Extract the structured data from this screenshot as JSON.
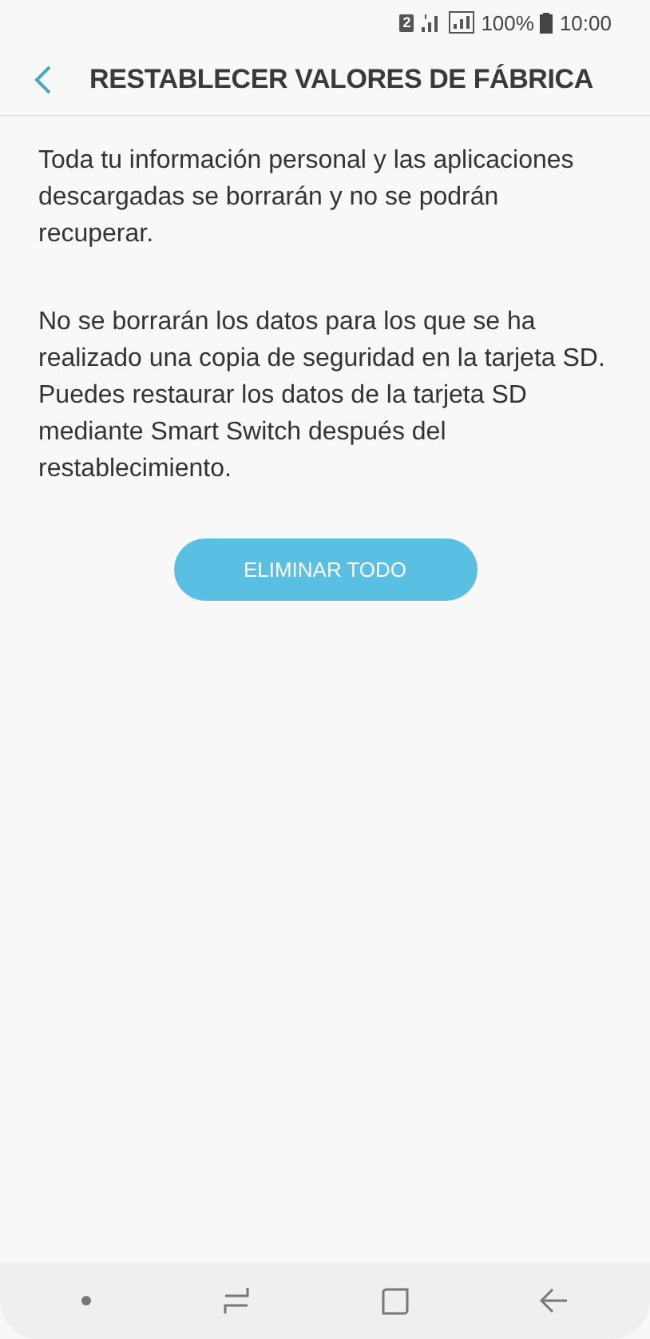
{
  "status_bar": {
    "sim": "2",
    "battery": "100%",
    "time": "10:00"
  },
  "header": {
    "title": "RESTABLECER VALORES DE FÁBRICA"
  },
  "paragraphs": [
    "Toda tu información personal y las aplicaciones descargadas se borrarán y no se podrán recuperar.",
    "No se borrarán los datos para los que se ha realizado una copia de seguridad en la tarjeta SD. Puedes restaurar los datos de la tarjeta SD mediante Smart Switch después del restablecimiento."
  ],
  "button": {
    "label": "ELIMINAR TODO"
  }
}
